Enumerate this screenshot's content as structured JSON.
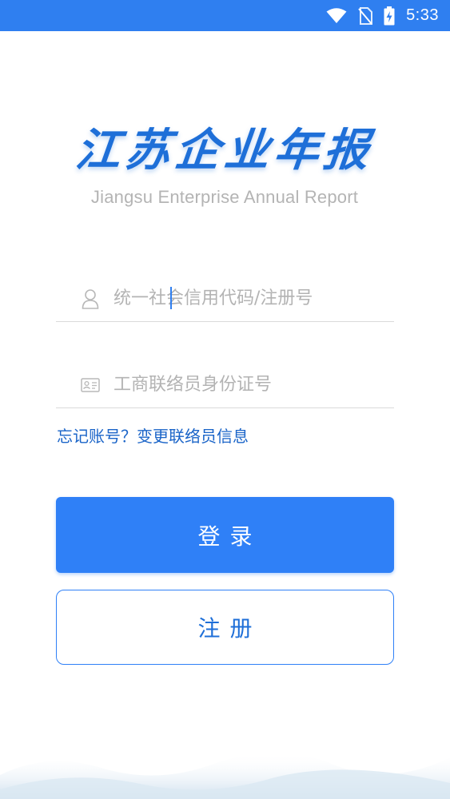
{
  "status_bar": {
    "time": "5:33",
    "icons": [
      "wifi-icon",
      "no-sim-icon",
      "battery-charging-icon"
    ],
    "background": "#2f7ff0"
  },
  "logo": {
    "title": "江苏企业年报",
    "subtitle": "Jiangsu Enterprise Annual Report"
  },
  "form": {
    "credit_code_placeholder": "统一社会信用代码/注册号",
    "credit_code_value": "",
    "id_number_placeholder": "工商联络员身份证号",
    "id_number_value": "",
    "forgot_link": "忘记账号？变更联络员信息"
  },
  "buttons": {
    "login": "登录",
    "register": "注册"
  },
  "colors": {
    "accent": "#2f80f7",
    "link": "#1a64c8"
  }
}
